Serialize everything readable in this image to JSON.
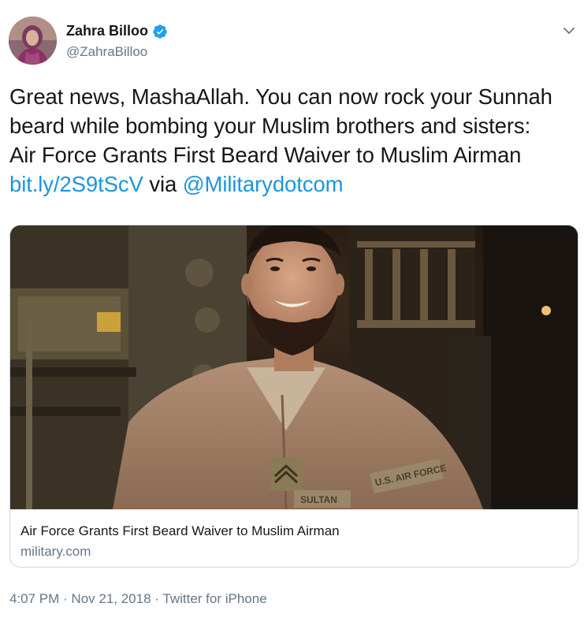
{
  "author": {
    "name": "Zahra Billoo",
    "handle": "@ZahraBilloo",
    "verified": true
  },
  "icons": {
    "verified": "verified-badge-icon",
    "menu": "chevron-down-icon"
  },
  "tweet": {
    "text_lines": [
      "Great news, MashaAllah. You can now rock your Sunnah",
      "beard while bombing your Muslim brothers and sisters:",
      "Air Force Grants First Beard Waiver to Muslim Airman"
    ],
    "link": "bit.ly/2S9tScV",
    "via": " via ",
    "mention": "@Militarydotcom"
  },
  "card": {
    "title": "Air Force Grants First Beard Waiver to Muslim Airman",
    "domain": "military.com",
    "image_patches": {
      "left": "U.S. AIR FORCE",
      "name": "SULTAN"
    }
  },
  "meta": {
    "time": "4:07 PM",
    "separator": " · ",
    "date": "Nov 21, 2018",
    "source": "Twitter for iPhone"
  },
  "colors": {
    "link": "#1b95e0",
    "verified": "#1da1f2",
    "secondary_text": "#657786",
    "primary_text": "#14171a",
    "border": "#ccd6dd"
  }
}
